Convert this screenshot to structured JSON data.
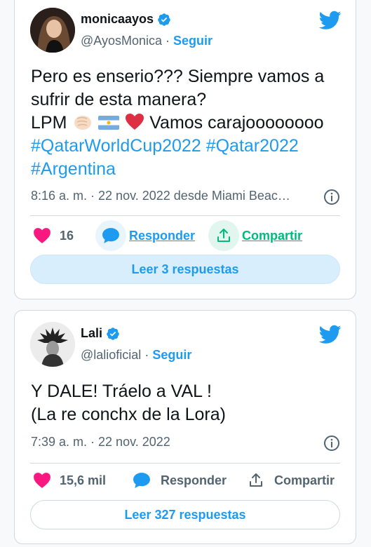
{
  "colors": {
    "accent": "#1d9bf0",
    "like": "#f91880",
    "share": "#00ba7c",
    "muted": "#536471"
  },
  "tweets": [
    {
      "display_name": "monicaayos",
      "handle": "@AyosMonica",
      "separator": "·",
      "follow_label": "Seguir",
      "text_line1": "Pero es enserio??? Siempre vamos a",
      "text_line2": "sufrir de esta manera?",
      "text_line3_prefix": "LPM",
      "text_line3_suffix": "Vamos carajoooooooo",
      "hashtag1": "#QatarWorldCup2022",
      "hashtag2": "#Qatar2022",
      "hashtag3": "#Argentina",
      "timestamp": "8:16 a. m. · 22 nov. 2022 desde Miami Beac…",
      "likes": "16",
      "reply_label": "Responder",
      "share_label": "Compartir",
      "read_replies_label": "Leer 3 respuestas",
      "emoji_icons": [
        "punch-light-skin-emoji",
        "argentina-flag-emoji",
        "red-heart-emoji"
      ]
    },
    {
      "display_name": "Lali",
      "handle": "@lalioficial",
      "separator": "·",
      "follow_label": "Seguir",
      "text_line1": "Y DALE! Tráelo a VAL !",
      "text_line2": "(La re conchx de la Lora)",
      "timestamp": "7:39 a. m. · 22 nov. 2022",
      "likes": "15,6 mil",
      "reply_label": "Responder",
      "share_label": "Compartir",
      "read_replies_label": "Leer 327 respuestas"
    }
  ]
}
